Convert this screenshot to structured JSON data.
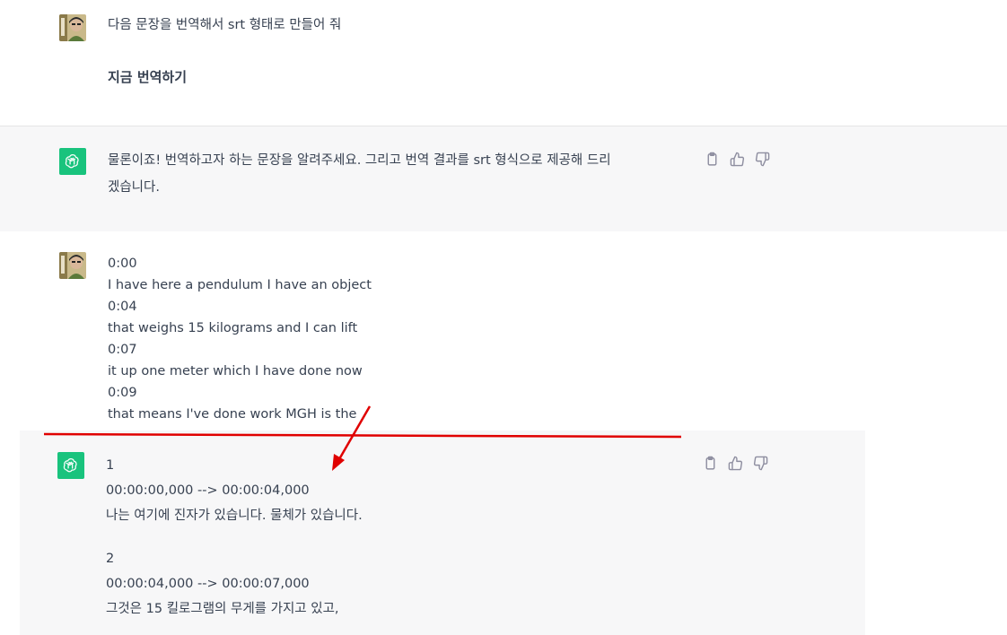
{
  "user_message_1": {
    "line1": "다음 문장을 번역해서 srt 형태로 만들어 줘",
    "line2": "지금 번역하기"
  },
  "assistant_message_1": {
    "line1": "물론이죠! 번역하고자 하는 문장을 알려주세요. 그리고 번역 결과를 srt 형식으로 제공해 드리",
    "line2": "겠습니다."
  },
  "user_message_2": {
    "lines": [
      "0:00",
      "I have here a pendulum I have an object",
      "0:04",
      "that weighs 15 kilograms and I can lift",
      "0:07",
      "it up one meter which I have done now",
      "0:09",
      "that means I've done work MGH is the"
    ]
  },
  "assistant_message_2": {
    "lines": [
      "1",
      "00:00:00,000 --> 00:00:04,000",
      "나는 여기에 진자가 있습니다. 물체가 있습니다.",
      "",
      "2",
      "00:00:04,000 --> 00:00:07,000",
      "그것은 15 킬로그램의 무게를 가지고 있고,"
    ]
  },
  "icons": {
    "copy": "clipboard-icon",
    "like": "thumbs-up-icon",
    "dislike": "thumbs-down-icon",
    "bot_avatar": "openai-logo-icon",
    "user_avatar": "user-photo-avatar"
  },
  "colors": {
    "bot_avatar_bg": "#19c37d",
    "assistant_band": "#f7f7f8",
    "text": "#374151",
    "annotation": "#e00000"
  }
}
